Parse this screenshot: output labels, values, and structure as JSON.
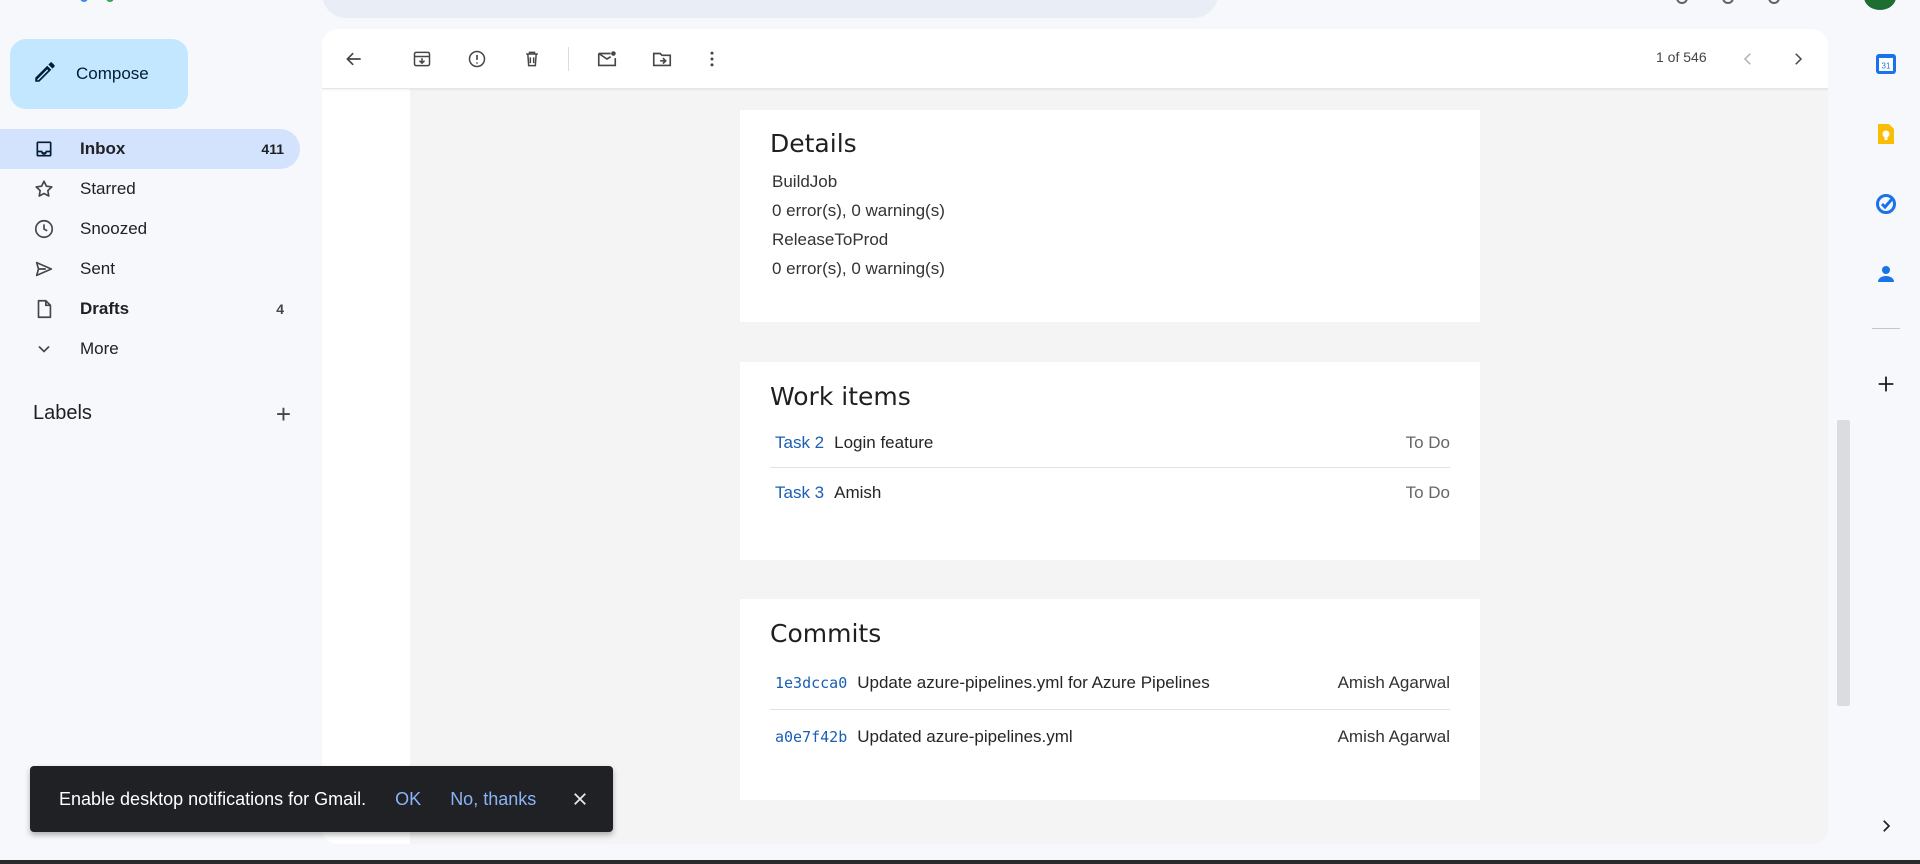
{
  "compose": {
    "label": "Compose"
  },
  "nav": [
    {
      "label": "Inbox",
      "count": "411"
    },
    {
      "label": "Starred",
      "count": ""
    },
    {
      "label": "Snoozed",
      "count": ""
    },
    {
      "label": "Sent",
      "count": ""
    },
    {
      "label": "Drafts",
      "count": "4"
    },
    {
      "label": "More",
      "count": ""
    }
  ],
  "labels": {
    "title": "Labels"
  },
  "toolbar": {
    "pager": "1 of 546"
  },
  "details": {
    "title": "Details",
    "lines": [
      "BuildJob",
      "0 error(s), 0 warning(s)",
      "ReleaseToProd",
      "0 error(s), 0 warning(s)"
    ]
  },
  "work_items": {
    "title": "Work items",
    "rows": [
      {
        "id": "Task 2",
        "title": "Login feature",
        "state": "To Do"
      },
      {
        "id": "Task 3",
        "title": "Amish",
        "state": "To Do"
      }
    ]
  },
  "commits": {
    "title": "Commits",
    "rows": [
      {
        "hash": "1e3dcca0",
        "message": "Update azure-pipelines.yml for Azure Pipelines",
        "author": "Amish Agarwal"
      },
      {
        "hash": "a0e7f42b",
        "message": "Updated azure-pipelines.yml",
        "author": "Amish Agarwal"
      }
    ]
  },
  "toast": {
    "text": "Enable desktop notifications for Gmail.",
    "ok": "OK",
    "no": "No, thanks"
  },
  "side_panel": {
    "calendar_day": "31"
  },
  "colors": {
    "accent": "#1a5fb4",
    "compose_bg": "#c2e7ff",
    "active_nav": "#d3e3fd"
  }
}
